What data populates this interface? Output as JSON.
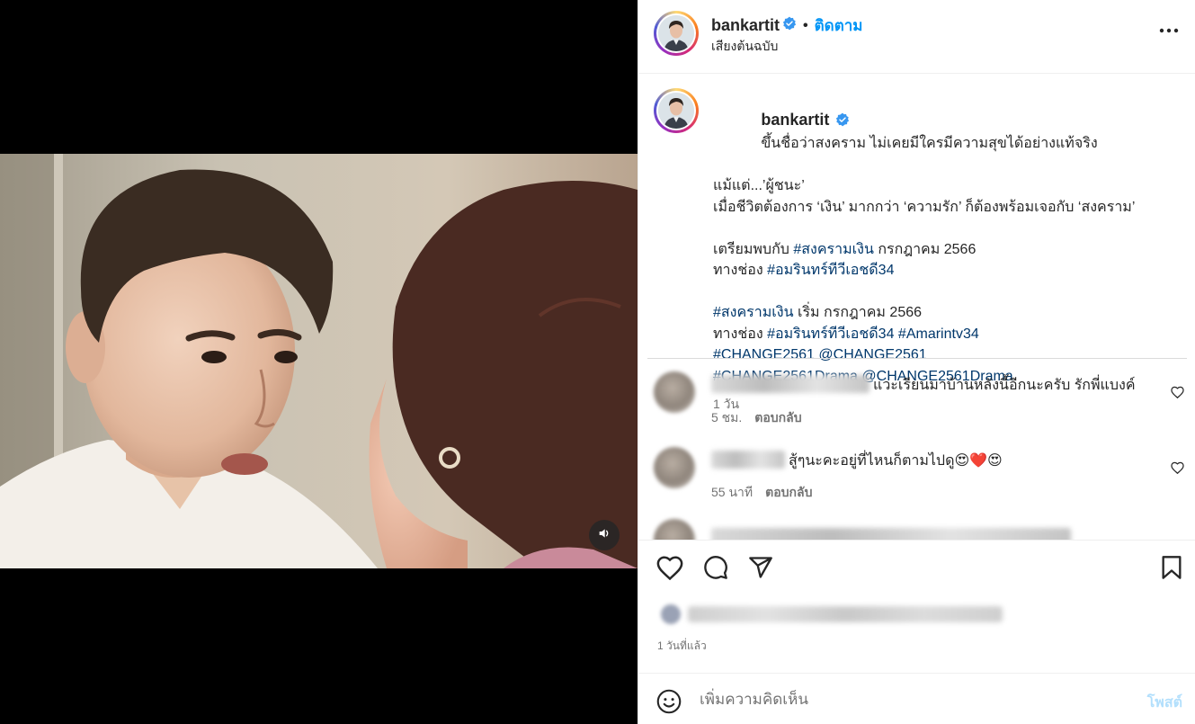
{
  "colors": {
    "accent": "#0095f6",
    "hashtag": "#00376b",
    "text": "#262626",
    "secondary": "#737373",
    "verified": "#3797f0",
    "post_disabled": "#b2dffc"
  },
  "media": {
    "mute_icon": "speaker-icon"
  },
  "header": {
    "username": "bankartit",
    "separator": "•",
    "follow_label": "ติดตาม",
    "audio_label": "เสียงต้นฉบับ",
    "more_icon": "more-horizontal-icon"
  },
  "caption": {
    "username": "bankartit",
    "line1": "ขึ้นชื่อว่าสงคราม ไม่เคยมีใครมีความสุขได้อย่างแท้จริง",
    "line2": "แม้แต่...’ผู้ชนะ’",
    "line3": "เมื่อชีวิตต้องการ ‘เงิน’ มากกว่า ‘ความรัก’ ก็ต้องพร้อมเจอกับ ‘สงคราม’",
    "line4_pre": "เตรียมพบกับ ",
    "line4_tag": "#สงครามเงิน",
    "line4_post": " กรกฎาคม 2566",
    "line5_pre": "ทางช่อง ",
    "line5_tag": "#อมรินทร์ทีวีเอชดี34",
    "line6_tag": "#สงครามเงิน",
    "line6_post": " เริ่ม กรกฎาคม 2566",
    "line7_pre": "ทางช่อง ",
    "line7_tag1": "#อมรินทร์ทีวีเอชดี34",
    "line7_tag2": "#Amarintv34",
    "line8_tag1": "#CHANGE2561",
    "line8_tag2": "@CHANGE2561",
    "line9_tag1": "#CHANGE2561Drama",
    "line9_tag2": "@CHANGE2561Drama",
    "time": "1 วัน"
  },
  "comments": [
    {
      "text": "แวะเรียนมาบ้านหลังนี้อีกนะครับ รักพี่แบงค์",
      "time": "5 ชม.",
      "reply_label": "ตอบกลับ"
    },
    {
      "text": "สู้ๆนะคะอยู่ที่ไหนก็ตามไปดู😍❤️😍",
      "time": "55 นาที",
      "reply_label": "ตอบกลับ"
    }
  ],
  "actions": {
    "like_icon": "heart-icon",
    "comment_icon": "comment-icon",
    "share_icon": "send-icon",
    "save_icon": "bookmark-icon"
  },
  "footer": {
    "timestamp": "1 วันที่แล้ว",
    "comment_placeholder": "เพิ่มความคิดเห็น",
    "post_label": "โพสต์",
    "emoji_icon": "smiley-icon"
  }
}
